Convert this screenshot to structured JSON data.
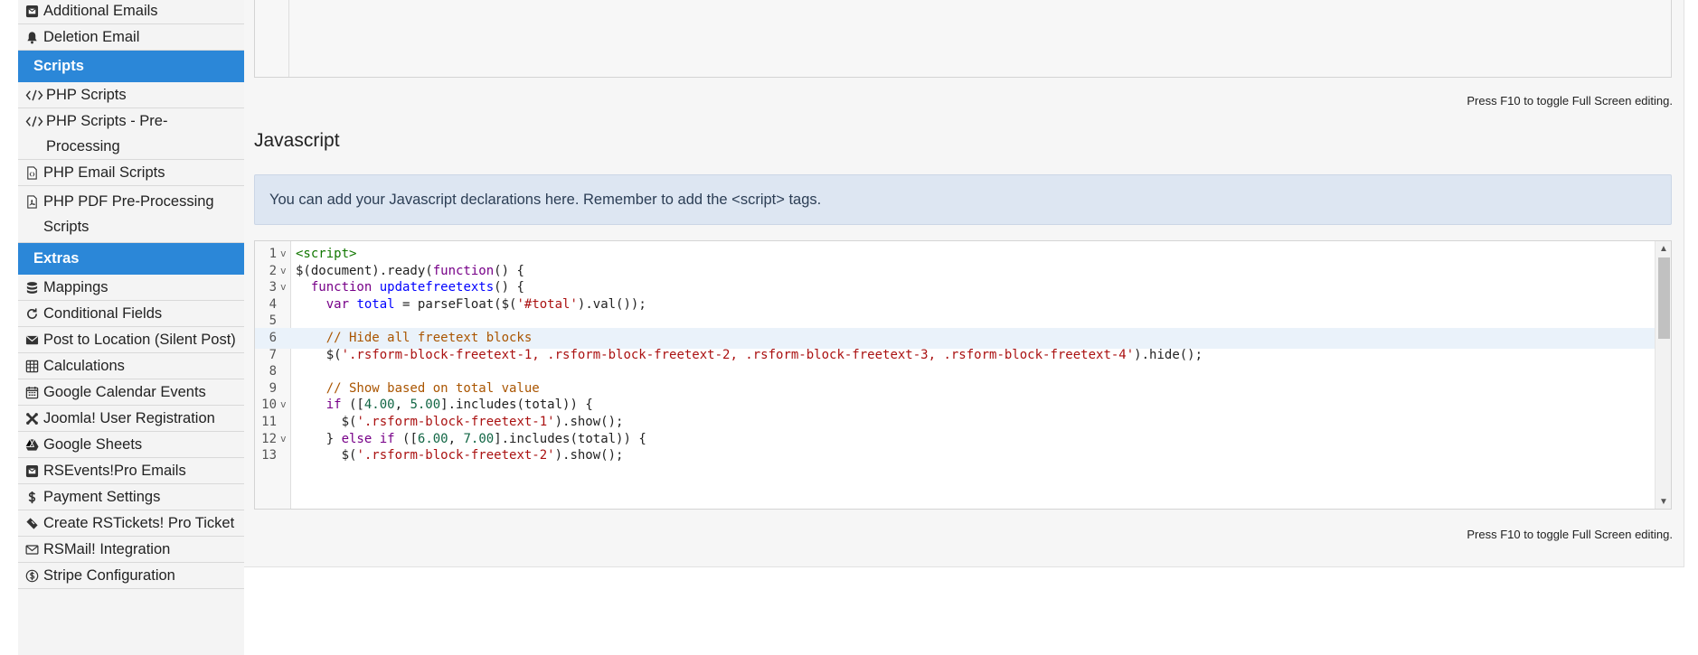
{
  "sidebar": {
    "items_top": [
      {
        "label": "Additional Emails",
        "icon": "envelope-square-icon"
      },
      {
        "label": "Deletion Email",
        "icon": "bell-icon"
      }
    ],
    "scripts_header": "Scripts",
    "scripts_items": [
      {
        "label": "PHP Scripts",
        "icon": "code-icon"
      },
      {
        "label": "PHP Scripts - Pre-Processing",
        "icon": "code-icon"
      },
      {
        "label": "PHP Email Scripts",
        "icon": "file-code-icon"
      },
      {
        "label": "PHP PDF Pre-Processing Scripts",
        "icon": "file-pdf-icon"
      }
    ],
    "extras_header": "Extras",
    "extras_items": [
      {
        "label": "Mappings",
        "icon": "database-icon"
      },
      {
        "label": "Conditional Fields",
        "icon": "refresh-icon"
      },
      {
        "label": "Post to Location (Silent Post)",
        "icon": "envelope-icon"
      },
      {
        "label": "Calculations",
        "icon": "calculator-icon"
      },
      {
        "label": "Google Calendar Events",
        "icon": "calendar-icon"
      },
      {
        "label": "Joomla! User Registration",
        "icon": "joomla-icon"
      },
      {
        "label": "Google Sheets",
        "icon": "google-drive-icon"
      },
      {
        "label": "RSEvents!Pro Emails",
        "icon": "envelope-square-icon"
      },
      {
        "label": "Payment Settings",
        "icon": "dollar-icon"
      },
      {
        "label": "Create RSTickets! Pro Ticket",
        "icon": "ticket-icon"
      },
      {
        "label": "RSMail! Integration",
        "icon": "envelope-open-icon"
      },
      {
        "label": "Stripe Configuration",
        "icon": "stripe-dollar-circle-icon"
      }
    ]
  },
  "main": {
    "fullscreen_hint_top": "Press F10 to toggle Full Screen editing.",
    "section_title": "Javascript",
    "alert_text": "You can add your Javascript declarations here. Remember to add the <script> tags.",
    "fullscreen_hint_bottom": "Press F10 to toggle Full Screen editing.",
    "code_lines": [
      {
        "n": "1",
        "fold": true,
        "text": "<script>"
      },
      {
        "n": "2",
        "fold": true,
        "text": "$(document).ready(function() {"
      },
      {
        "n": "3",
        "fold": true,
        "text": "  function updatefreetexts() {"
      },
      {
        "n": "4",
        "fold": false,
        "text": "    var total = parseFloat($('#total').val());"
      },
      {
        "n": "5",
        "fold": false,
        "text": ""
      },
      {
        "n": "6",
        "fold": false,
        "text": "    // Hide all freetext blocks",
        "active": true
      },
      {
        "n": "7",
        "fold": false,
        "text": "    $('.rsform-block-freetext-1, .rsform-block-freetext-2, .rsform-block-freetext-3, .rsform-block-freetext-4').hide();"
      },
      {
        "n": "8",
        "fold": false,
        "text": ""
      },
      {
        "n": "9",
        "fold": false,
        "text": "    // Show based on total value"
      },
      {
        "n": "10",
        "fold": true,
        "text": "    if ([4.00, 5.00].includes(total)) {"
      },
      {
        "n": "11",
        "fold": false,
        "text": "      $('.rsform-block-freetext-1').show();"
      },
      {
        "n": "12",
        "fold": true,
        "text": "    } else if ([6.00, 7.00].includes(total)) {"
      },
      {
        "n": "13",
        "fold": false,
        "text": "      $('.rsform-block-freetext-2').show();"
      }
    ]
  },
  "colors": {
    "sidebar_header": "#2b87d8",
    "alert_bg": "#dde6f2",
    "code_keyword": "#770088",
    "code_string": "#aa1111",
    "code_comment": "#aa5500",
    "code_number": "#116644",
    "code_tag": "#117700"
  }
}
